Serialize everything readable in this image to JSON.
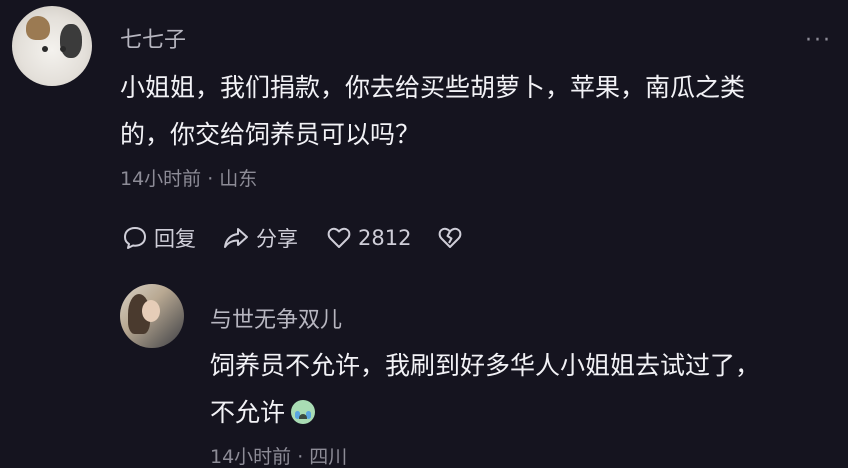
{
  "main_comment": {
    "username": "七七子",
    "text_line1": "小姐姐，我们捐款，你去给买些胡萝卜，苹果，南瓜之类",
    "text_line2": "的，你交给饲养员可以吗？",
    "meta": "14小时前 · 山东",
    "more_label": "···"
  },
  "actions": {
    "reply_label": "回复",
    "share_label": "分享",
    "like_count": "2812",
    "icons": [
      "comment-bubble-icon",
      "share-arrow-icon",
      "heart-icon",
      "broken-heart-icon"
    ]
  },
  "reply_comment": {
    "username": "与世无争双儿",
    "text_line1": "饲养员不允许，我刷到好多华人小姐姐去试过了，",
    "text_line2": "不允许",
    "emoji": "crying-face-emoji",
    "meta": "14小时前 · 四川"
  },
  "colors": {
    "background": "#15141f",
    "text_primary": "#f2f2f6",
    "text_secondary": "#8d8c97"
  }
}
